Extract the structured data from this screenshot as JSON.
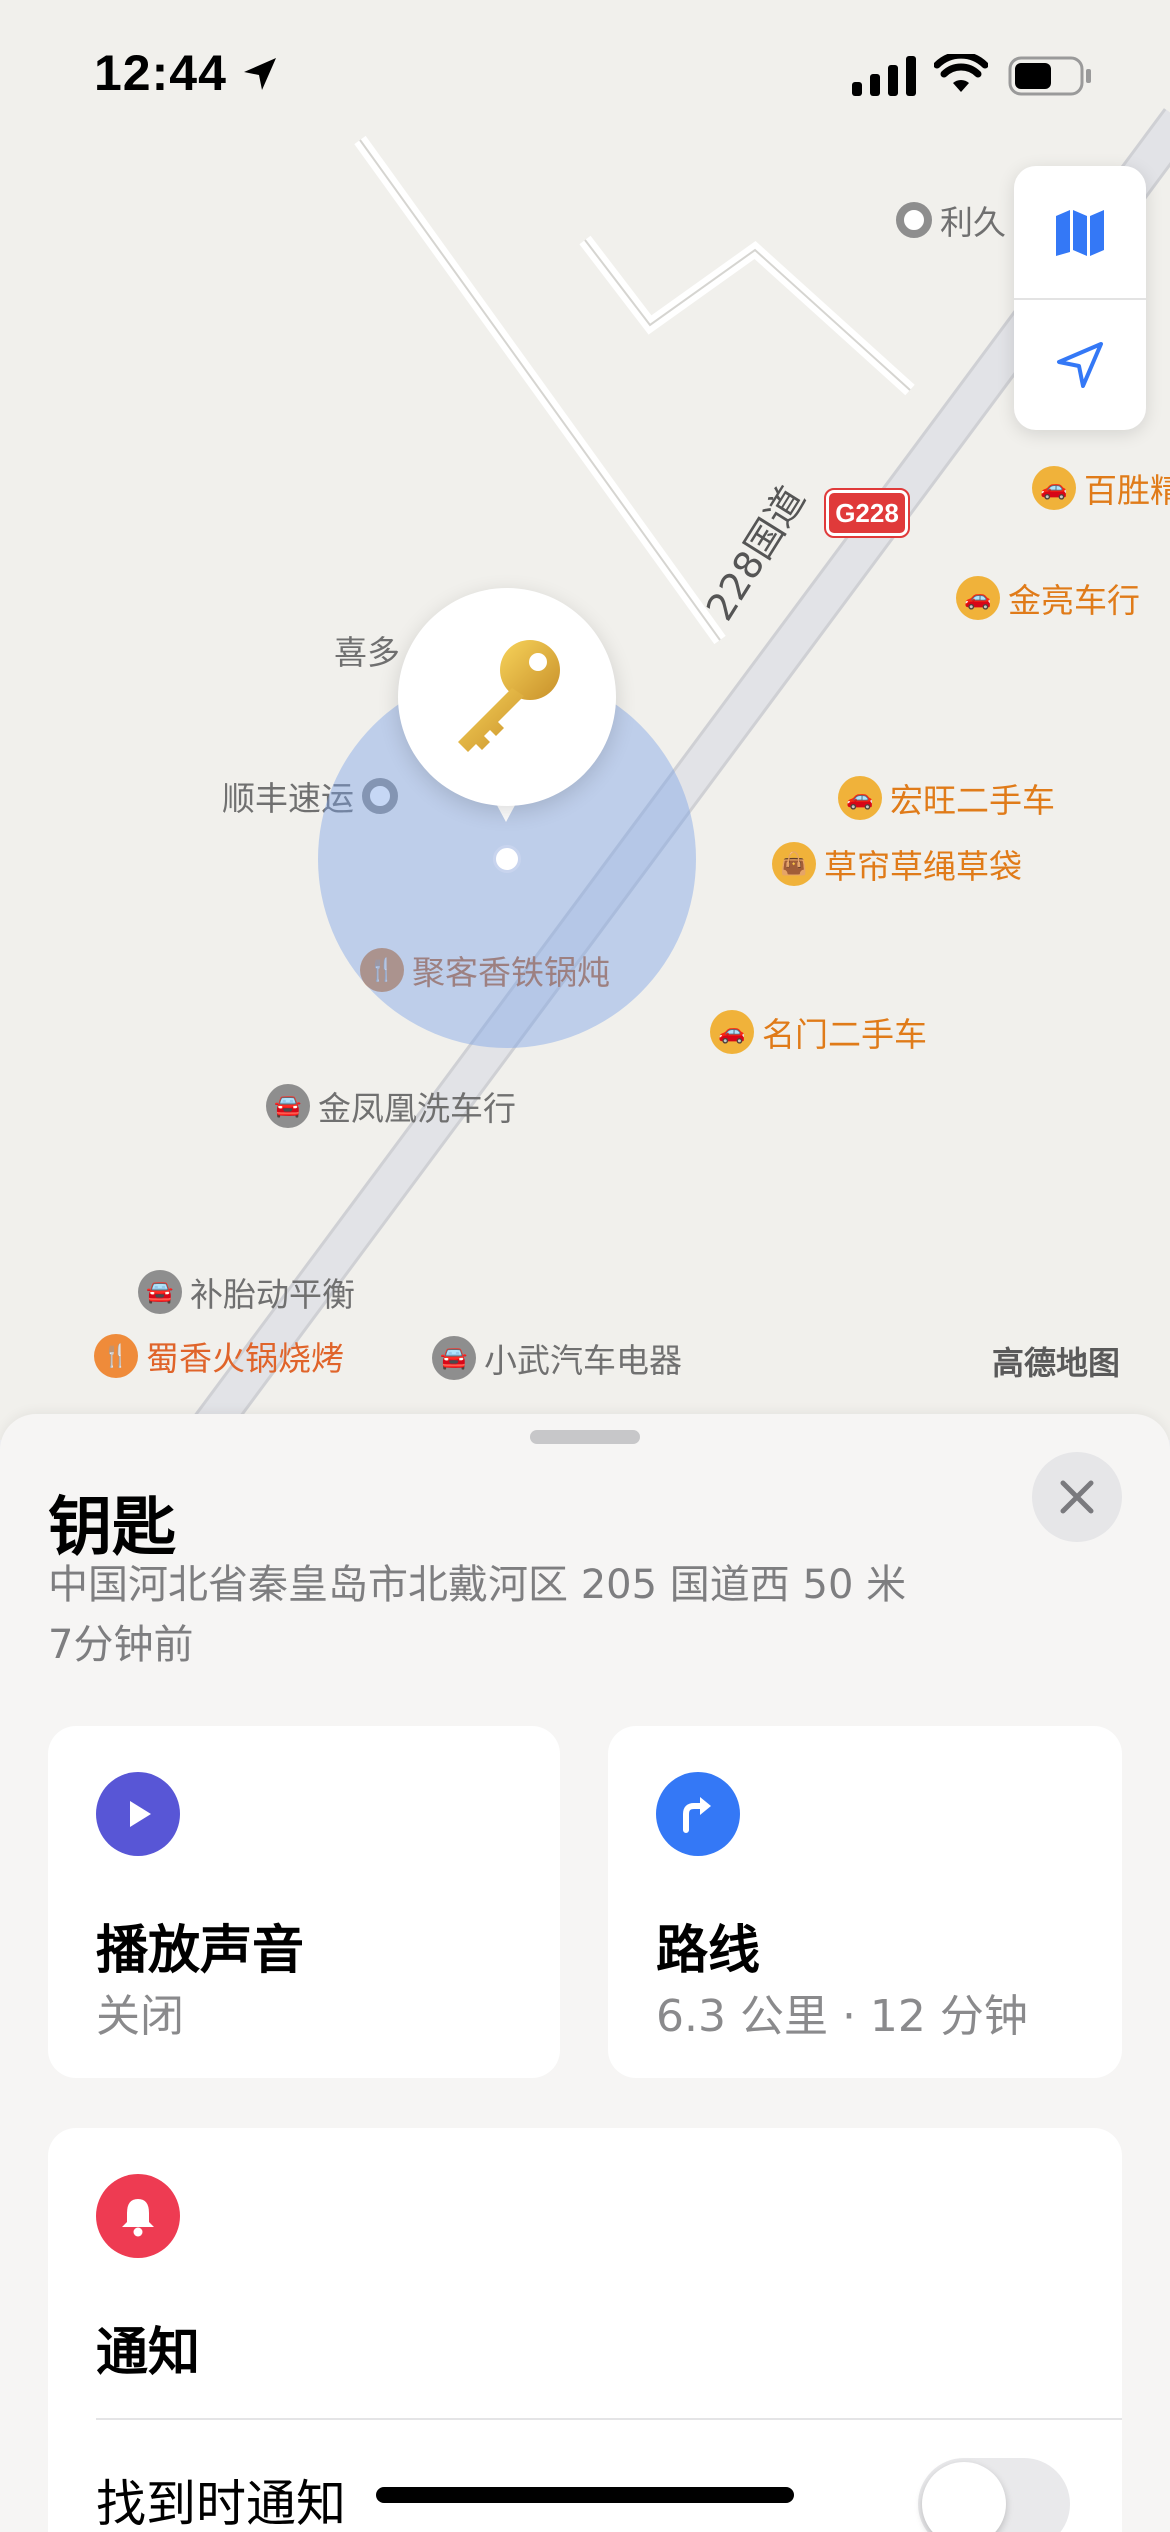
{
  "status_bar": {
    "time": "12:44"
  },
  "map": {
    "road_shield": "G228",
    "road_label": "228国道",
    "attribution": "高德地图",
    "pois": [
      {
        "id": "lijiu",
        "name": "利久",
        "style": "gray",
        "icon": "ring-icon"
      },
      {
        "id": "baisheng",
        "name": "百胜精",
        "style": "orange",
        "icon": "car-icon"
      },
      {
        "id": "jinliang",
        "name": "金亮车行",
        "style": "orange",
        "icon": "car-icon"
      },
      {
        "id": "xiduo",
        "name": "喜多",
        "style": "gray",
        "icon": "ring-icon"
      },
      {
        "id": "shunfeng",
        "name": "顺丰速运",
        "style": "gray",
        "icon": "ring-icon"
      },
      {
        "id": "hongwang",
        "name": "宏旺二手车",
        "style": "orange",
        "icon": "car-icon"
      },
      {
        "id": "caolian",
        "name": "草帘草绳草袋",
        "style": "orange",
        "icon": "bag-icon"
      },
      {
        "id": "jukexiang",
        "name": "聚客香铁锅炖",
        "style": "brown",
        "icon": "fork-icon"
      },
      {
        "id": "mingmen",
        "name": "名门二手车",
        "style": "orange",
        "icon": "car-icon"
      },
      {
        "id": "jinfenghuang",
        "name": "金凤凰洗车行",
        "style": "gray",
        "icon": "car-wash-icon"
      },
      {
        "id": "butai",
        "name": "补胎动平衡",
        "style": "gray",
        "icon": "car-wash-icon"
      },
      {
        "id": "shuxiang",
        "name": "蜀香火锅烧烤",
        "style": "red",
        "icon": "fork-icon"
      },
      {
        "id": "xiaowu",
        "name": "小武汽车电器",
        "style": "gray",
        "icon": "car-wash-icon"
      }
    ]
  },
  "sheet": {
    "title": "钥匙",
    "address": "中国河北省秦皇岛市北戴河区 205 国道西 50 米",
    "time_ago": "7分钟前",
    "sound_card": {
      "title": "播放声音",
      "subtitle": "关闭",
      "icon": "play-icon",
      "color": "#5856d6"
    },
    "route_card": {
      "title": "路线",
      "subtitle": "6.3 公里 · 12 分钟",
      "icon": "turn-right-icon",
      "color": "#3478f6"
    },
    "notify_card": {
      "title": "通知",
      "icon": "bell-icon",
      "color": "#ee3b52",
      "row_label": "找到时通知",
      "toggle_on": false
    }
  }
}
